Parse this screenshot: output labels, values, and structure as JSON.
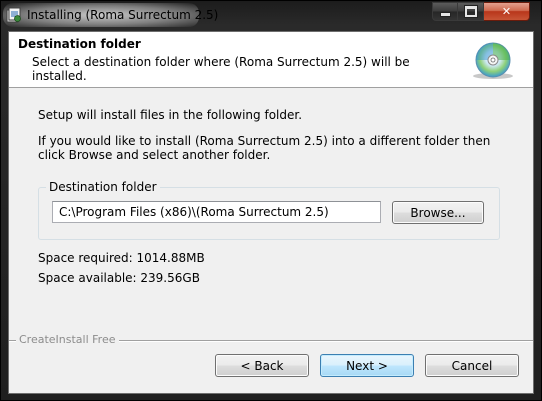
{
  "window": {
    "title": "Installing (Roma Surrectum 2.5)",
    "caption_close": "✕"
  },
  "header": {
    "title": "Destination folder",
    "subtitle": "Select a destination folder where (Roma Surrectum 2.5) will be installed.",
    "icon": "cd-disc-icon"
  },
  "body": {
    "intro_line1": "Setup will install files in the following folder.",
    "intro_line2": "If you would like to install (Roma Surrectum 2.5) into a different folder then click Browse and select another folder.",
    "group_label": "Destination folder",
    "path_value": "C:\\Program Files (x86)\\(Roma Surrectum 2.5)",
    "browse_label": "Browse...",
    "space_required": "Space required: 1014.88MB",
    "space_available": "Space available: 239.56GB"
  },
  "footer": {
    "brand": "CreateInstall Free",
    "back_label": "< Back",
    "next_label": "Next >",
    "cancel_label": "Cancel"
  },
  "colors": {
    "title_bar": "#1f1f1f",
    "close_button": "#c85536",
    "client_background": "#f0f0f0",
    "default_button_accent": "#3c7fb1"
  }
}
